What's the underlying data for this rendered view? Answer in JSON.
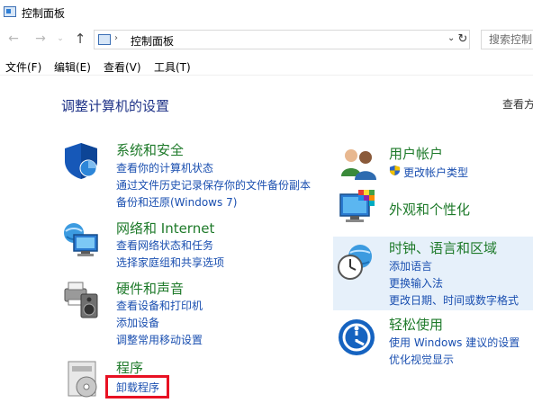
{
  "window": {
    "title": "控制面板"
  },
  "nav": {
    "back": "←",
    "forward": "→",
    "recent": "⌄",
    "up": "↑",
    "breadcrumb_sep": "›",
    "breadcrumb": "控制面板",
    "dropdown": "⌄",
    "refresh": "↻",
    "search_placeholder": "搜索控制"
  },
  "menu": [
    "文件(F)",
    "编辑(E)",
    "查看(V)",
    "工具(T)"
  ],
  "main": {
    "heading": "调整计算机的设置",
    "view_by": "查看方"
  },
  "left_categories": [
    {
      "title": "系统和安全",
      "icon": "shield-icon",
      "links": [
        "查看你的计算机状态",
        "通过文件历史记录保存你的文件备份副本",
        "备份和还原(Windows 7)"
      ]
    },
    {
      "title": "网络和 Internet",
      "icon": "network-globe-icon",
      "links": [
        "查看网络状态和任务",
        "选择家庭组和共享选项"
      ]
    },
    {
      "title": "硬件和声音",
      "icon": "printer-speaker-icon",
      "links": [
        "查看设备和打印机",
        "添加设备",
        "调整常用移动设置"
      ]
    },
    {
      "title": "程序",
      "icon": "programs-disc-icon",
      "links": [
        "卸载程序"
      ]
    }
  ],
  "right_categories": [
    {
      "title": "用户帐户",
      "icon": "users-icon",
      "links": [
        "更改帐户类型"
      ]
    },
    {
      "title": "外观和个性化",
      "icon": "monitor-palette-icon",
      "links": []
    },
    {
      "title": "时钟、语言和区域",
      "icon": "clock-globe-icon",
      "links": [
        "添加语言",
        "更换输入法",
        "更改日期、时间或数字格式"
      ]
    },
    {
      "title": "轻松使用",
      "icon": "ease-of-access-icon",
      "links": [
        "使用 Windows 建议的设置",
        "优化视觉显示"
      ]
    }
  ],
  "colors": {
    "category_title": "#1e7a2a",
    "link": "#1a4fb0",
    "heading": "#1e3287",
    "hover_panel": "#e6f0fa",
    "highlight_box": "#e81123"
  }
}
